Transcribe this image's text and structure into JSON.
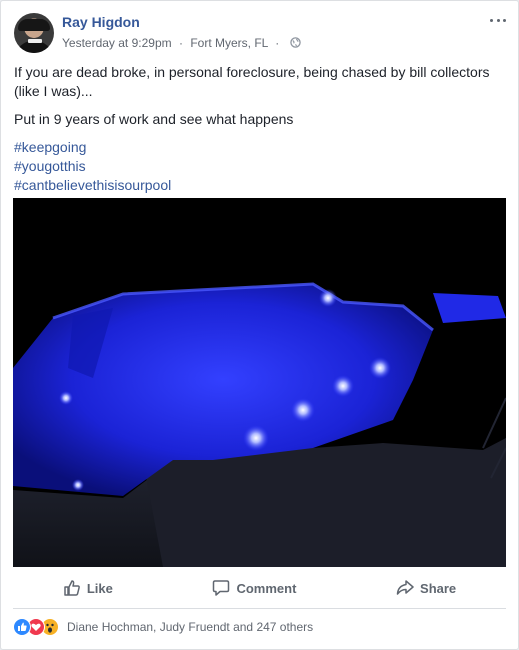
{
  "post": {
    "author": "Ray Higdon",
    "time": "Yesterday at 9:29pm",
    "separator": "·",
    "location": "Fort Myers, FL",
    "privacy_icon": "globe-icon",
    "paragraphs": [
      "If you are dead broke, in personal foreclosure, being chased by bill collectors (like I was)...",
      "Put in 9 years of work and see what happens"
    ],
    "hashtags": [
      "#keepgoing",
      "#yougotthis",
      "#cantbelievethisisourpool"
    ]
  },
  "actions": {
    "like": "Like",
    "comment": "Comment",
    "share": "Share"
  },
  "reactions": {
    "icons": [
      "like-icon",
      "love-icon",
      "wow-icon"
    ],
    "summary": "Diane Hochman, Judy Fruendt and 247 others"
  },
  "colors": {
    "link": "#365899",
    "text": "#1d2129",
    "muted": "#616770",
    "pool_light": "#1f2fff"
  }
}
